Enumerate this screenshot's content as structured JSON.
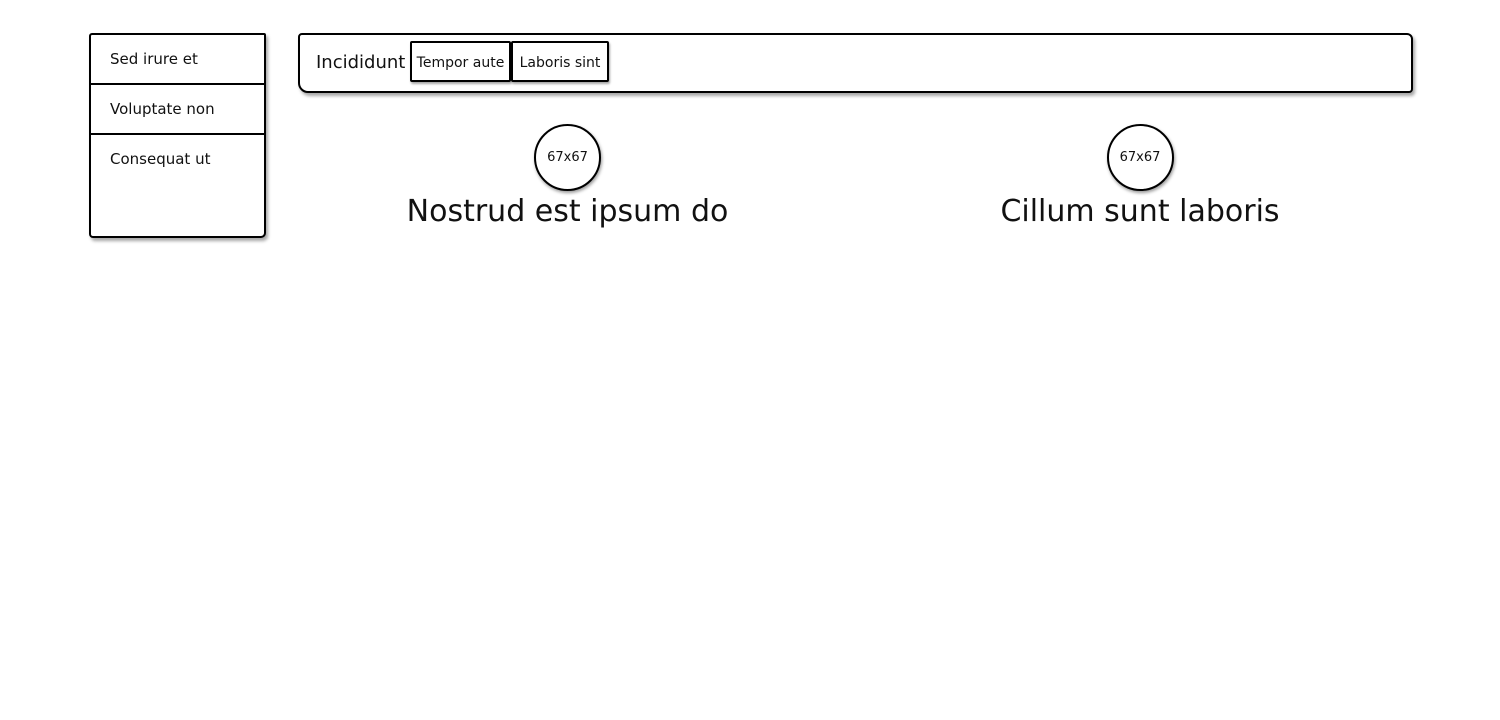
{
  "sidebar": {
    "items": [
      {
        "label": "Sed irure et"
      },
      {
        "label": "Voluptate non"
      },
      {
        "label": "Consequat ut"
      }
    ]
  },
  "navbar": {
    "brand": "Incididunt",
    "buttons": [
      {
        "label": "Tempor aute"
      },
      {
        "label": "Laboris sint"
      }
    ]
  },
  "cards": [
    {
      "image_label": "67x67",
      "title": "Nostrud est ipsum do"
    },
    {
      "image_label": "67x67",
      "title": "Cillum sunt laboris"
    }
  ]
}
